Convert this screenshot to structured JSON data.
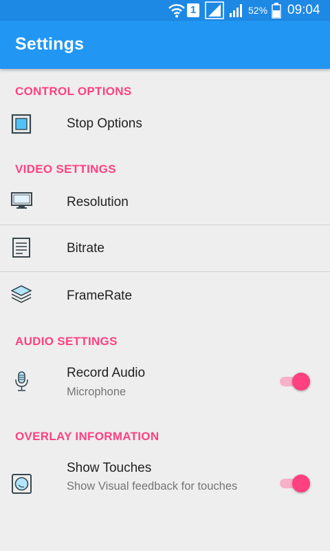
{
  "status_bar": {
    "sim_badge": "1",
    "battery_percent": "52%",
    "time": "09:04",
    "icons": [
      "wifi-icon",
      "sim-icon",
      "signal-icon",
      "signal-icon",
      "battery-icon"
    ]
  },
  "app_bar": {
    "title": "Settings",
    "color": "#2196f3"
  },
  "accent_color": "#ff4081",
  "sections": {
    "control": {
      "header": "CONTROL OPTIONS",
      "items": [
        {
          "title": "Stop Options",
          "icon": "stop-square-icon"
        }
      ]
    },
    "video": {
      "header": "VIDEO SETTINGS",
      "items": [
        {
          "title": "Resolution",
          "icon": "monitor-icon"
        },
        {
          "title": "Bitrate",
          "icon": "document-lines-icon"
        },
        {
          "title": "FrameRate",
          "icon": "layers-icon"
        }
      ]
    },
    "audio": {
      "header": "AUDIO SETTINGS",
      "items": [
        {
          "title": "Record Audio",
          "subtitle": "Microphone",
          "icon": "microphone-icon",
          "enabled": true
        }
      ]
    },
    "overlay": {
      "header": "OVERLAY INFORMATION",
      "items": [
        {
          "title": "Show Touches",
          "subtitle": "Show Visual feedback for touches",
          "icon": "touch-circle-icon",
          "enabled": true
        }
      ]
    }
  }
}
